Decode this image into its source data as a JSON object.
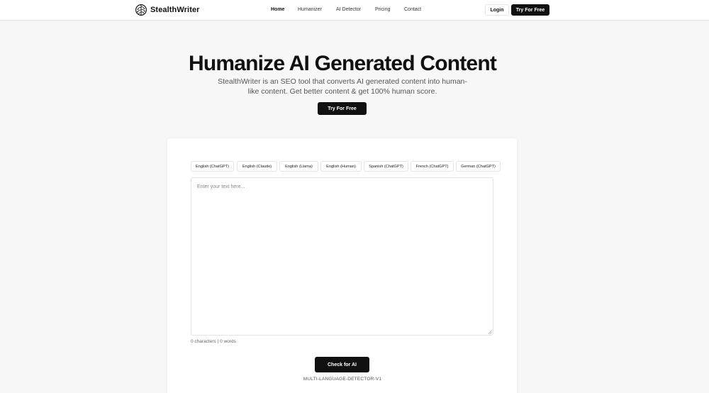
{
  "nav": {
    "brand": "StealthWriter",
    "logo_icon": "brain-icon",
    "links": [
      "Home",
      "Humanizer",
      "AI Detector",
      "Pricing",
      "Contact"
    ],
    "active_link": "Home",
    "login_label": "Login",
    "try_label": "Try For Free"
  },
  "hero": {
    "title": "Humanize AI Generated Content",
    "subtitle": "StealthWriter is an SEO tool that converts AI generated content into human-like content. Get better content & get 100% human score.",
    "cta_label": "Try For Free"
  },
  "detector": {
    "models": [
      "English (ChatGPT)",
      "English (Claude)",
      "English (Llama)",
      "English (Human)",
      "Spanish (ChatGPT)",
      "French (ChatGPT)",
      "German (ChatGPT)"
    ],
    "placeholder": "Enter your text here...",
    "counter": "0 characters | 0 words",
    "check_label": "Check for AI",
    "model_name": "MULTI-LANGUAGE-DETECTOR-V1"
  },
  "colors": {
    "primary": "#111111",
    "background": "#f7f7f7",
    "surface": "#ffffff"
  }
}
